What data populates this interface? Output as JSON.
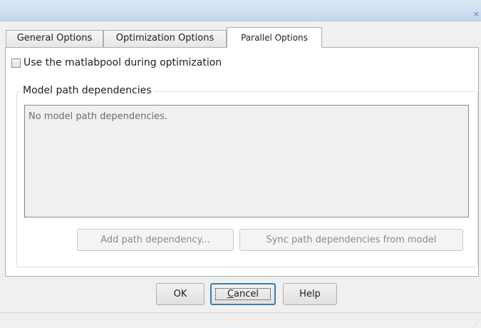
{
  "window": {
    "close_glyph": "×"
  },
  "tabs": [
    {
      "label": "General Options",
      "active": false
    },
    {
      "label": "Optimization Options",
      "active": false
    },
    {
      "label": "Parallel Options",
      "active": true
    }
  ],
  "parallel": {
    "use_matlabpool_label": "Use the matlabpool during optimization",
    "use_matlabpool_checked": false,
    "group_title": "Model path dependencies",
    "dependencies_empty_text": "No model path dependencies.",
    "add_button_label": "Add path dependency...",
    "sync_button_label": "Sync path dependencies from model"
  },
  "footer": {
    "ok_label": "OK",
    "cancel_label_underlined": "C",
    "cancel_label_rest": "ancel",
    "help_label": "Help"
  },
  "icons": {
    "close": "close-icon",
    "checkbox": "checkbox-icon",
    "resize_grip": "resize-grip-icon"
  },
  "colors": {
    "titlebar": "#c4d6ec",
    "focus_border": "#3c7fb1"
  }
}
